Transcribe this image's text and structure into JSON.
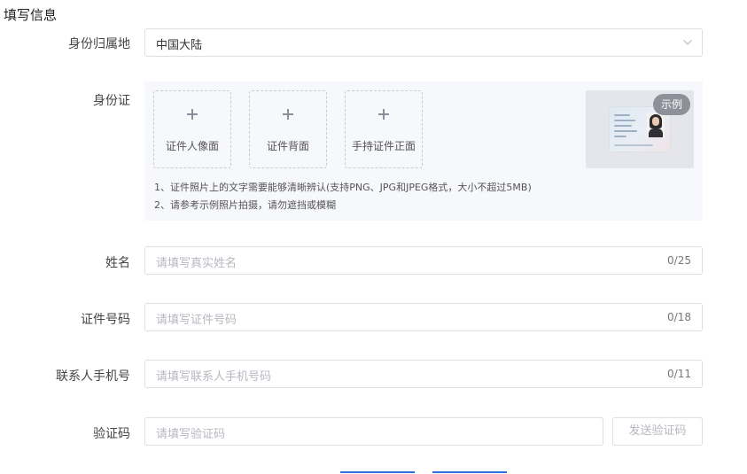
{
  "form": {
    "title": "填写信息",
    "region": {
      "label": "身份归属地",
      "value": "中国大陆"
    },
    "id_card": {
      "label": "身份证",
      "upload_slots": [
        {
          "label": "证件人像面"
        },
        {
          "label": "证件背面"
        },
        {
          "label": "手持证件正面"
        }
      ],
      "notes": [
        "1、证件照片上的文字需要能够清晰辨认(支持PNG、JPG和JPEG格式，大小不超过5MB)",
        "2、请参考示例照片拍摄，请勿遮挡或模糊"
      ],
      "example_badge": "示例"
    },
    "name": {
      "label": "姓名",
      "placeholder": "请填写真实姓名",
      "counter": "0/25"
    },
    "id_number": {
      "label": "证件号码",
      "placeholder": "请填写证件号码",
      "counter": "0/18"
    },
    "phone": {
      "label": "联系人手机号",
      "placeholder": "请填写联系人手机号码",
      "counter": "0/11"
    },
    "verify_code": {
      "label": "验证码",
      "placeholder": "请填写验证码",
      "send_button": "发送验证码"
    }
  },
  "colors": {
    "accent": "#2f6fe0",
    "border": "#dcdfe6",
    "placeholder": "#b5b8bf",
    "panel_bg": "#f7f8fc"
  }
}
